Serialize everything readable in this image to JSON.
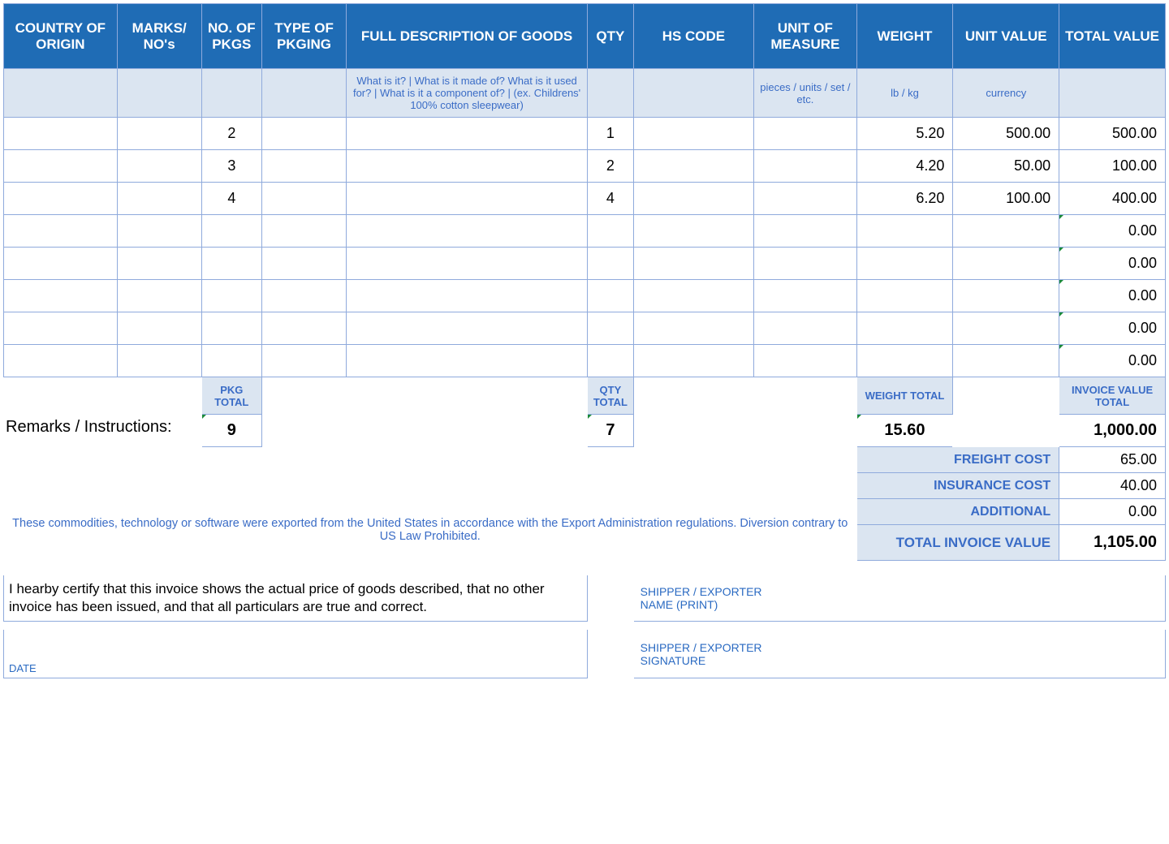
{
  "headers": {
    "c1": "COUNTRY OF ORIGIN",
    "c2": "MARKS/ NO's",
    "c3": "NO. OF PKGS",
    "c4": "TYPE OF PKGING",
    "c5": "FULL DESCRIPTION OF GOODS",
    "c6": "QTY",
    "c7": "HS CODE",
    "c8": "UNIT OF MEASURE",
    "c9": "WEIGHT",
    "c10": "UNIT VALUE",
    "c11": "TOTAL VALUE"
  },
  "hints": {
    "desc": "What is it? | What is it made of? What is it used for? | What is it a component of? | (ex. Childrens' 100% cotton sleepwear)",
    "uom": "pieces / units / set / etc.",
    "weight": "lb / kg",
    "unitval": "currency"
  },
  "rows": [
    {
      "pkgs": "2",
      "qty": "1",
      "weight": "5.20",
      "unit": "500.00",
      "total": "500.00",
      "flag": false
    },
    {
      "pkgs": "3",
      "qty": "2",
      "weight": "4.20",
      "unit": "50.00",
      "total": "100.00",
      "flag": false
    },
    {
      "pkgs": "4",
      "qty": "4",
      "weight": "6.20",
      "unit": "100.00",
      "total": "400.00",
      "flag": false
    },
    {
      "pkgs": "",
      "qty": "",
      "weight": "",
      "unit": "",
      "total": "0.00",
      "flag": true
    },
    {
      "pkgs": "",
      "qty": "",
      "weight": "",
      "unit": "",
      "total": "0.00",
      "flag": true
    },
    {
      "pkgs": "",
      "qty": "",
      "weight": "",
      "unit": "",
      "total": "0.00",
      "flag": true
    },
    {
      "pkgs": "",
      "qty": "",
      "weight": "",
      "unit": "",
      "total": "0.00",
      "flag": true
    },
    {
      "pkgs": "",
      "qty": "",
      "weight": "",
      "unit": "",
      "total": "0.00",
      "flag": true
    }
  ],
  "subtotals": {
    "pkg_label": "PKG TOTAL",
    "qty_label": "QTY TOTAL",
    "weight_label": "WEIGHT TOTAL",
    "inv_label": "INVOICE VALUE TOTAL",
    "pkg": "9",
    "qty": "7",
    "weight": "15.60",
    "invoice": "1,000.00"
  },
  "remarks_label": "Remarks / Instructions:",
  "summary": {
    "freight_label": "FREIGHT COST",
    "insurance_label": "INSURANCE COST",
    "additional_label": "ADDITIONAL",
    "total_label": "TOTAL INVOICE VALUE",
    "freight": "65.00",
    "insurance": "40.00",
    "additional": "0.00",
    "total": "1,105.00"
  },
  "disclaimer": "These commodities, technology or software were exported from the United States in accordance with the Export Administration regulations.  Diversion contrary to US Law Prohibited.",
  "certify": "I hearby certify that this invoice shows the actual price of goods described, that no other invoice has been issued, and that all particulars are true and correct.",
  "sig": {
    "name1a": "SHIPPER / EXPORTER",
    "name1b": "NAME (PRINT)",
    "name2a": "SHIPPER / EXPORTER",
    "name2b": "SIGNATURE",
    "date": "DATE"
  }
}
